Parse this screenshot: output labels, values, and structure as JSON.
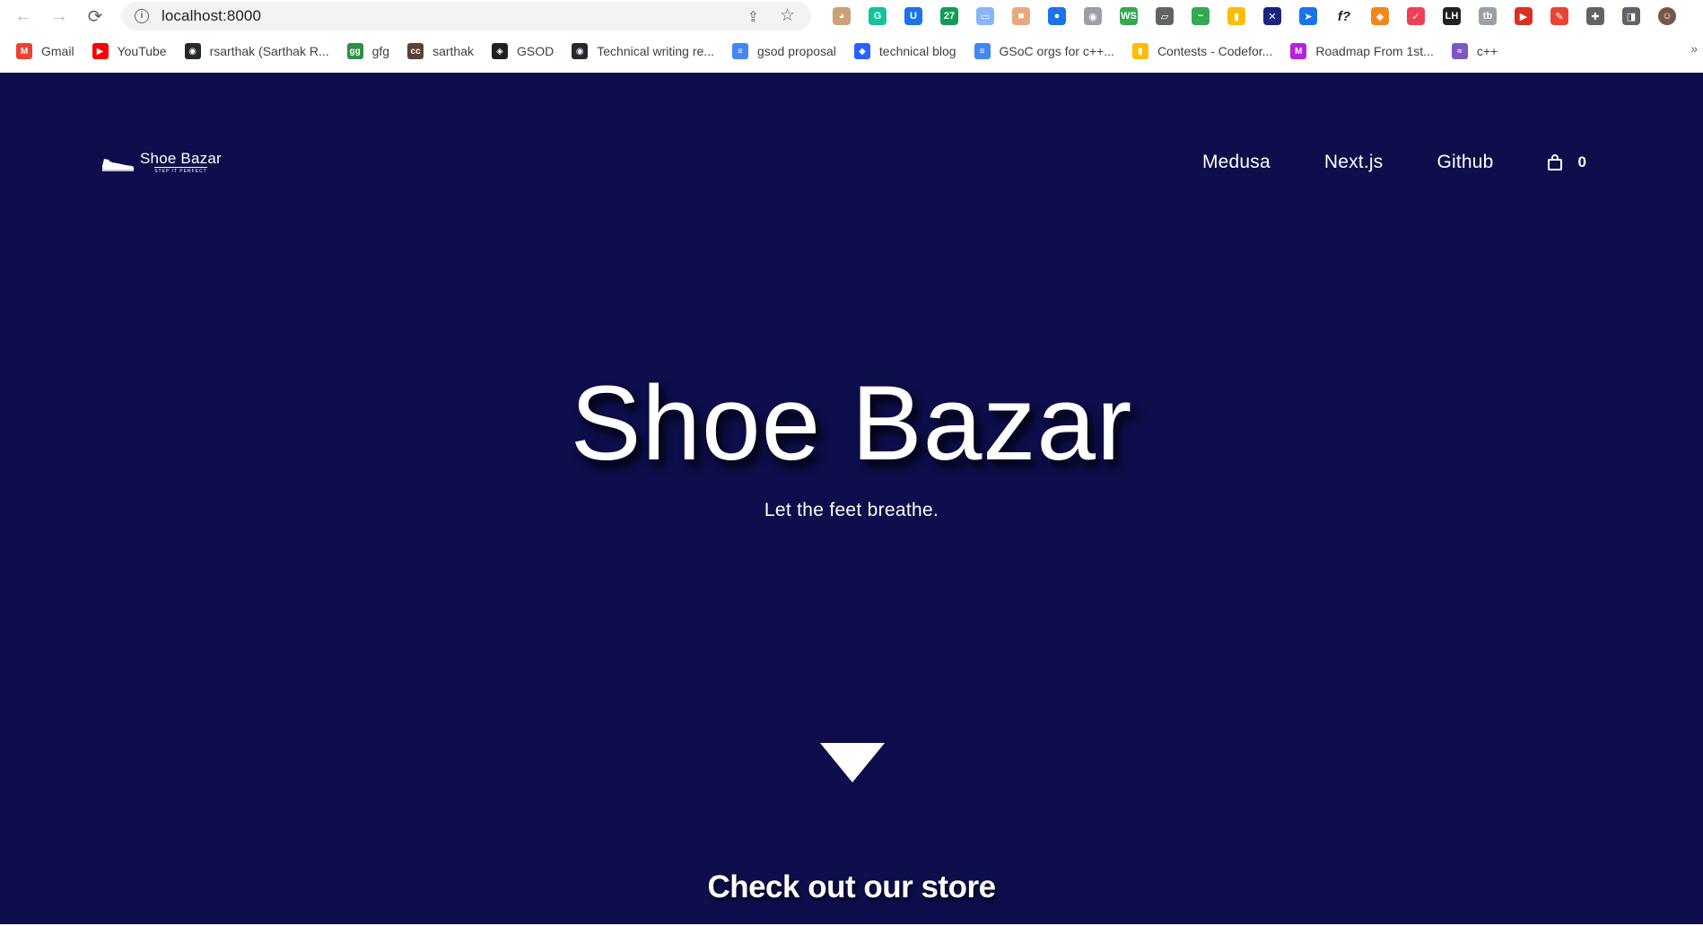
{
  "browser": {
    "url": "localhost:8000",
    "nav": {
      "back_icon": "←",
      "forward_icon": "→",
      "reload_icon": "⟳"
    },
    "extensions": [
      {
        "name": "face-ext-icon",
        "label": "◕",
        "color": "#c9a27a"
      },
      {
        "name": "grammarly-icon",
        "label": "G",
        "color": "#15c39a"
      },
      {
        "name": "u-ext-icon",
        "label": "U",
        "color": "#1a73e8"
      },
      {
        "name": "calendar-27-icon",
        "label": "27",
        "color": "#0f9d58"
      },
      {
        "name": "tab-ext-icon",
        "label": "▭",
        "color": "#8ab4f8"
      },
      {
        "name": "box-ext-icon",
        "label": "■",
        "color": "#e8a87c"
      },
      {
        "name": "screen-capture-icon",
        "label": "●",
        "color": "#1a73e8"
      },
      {
        "name": "disc-ext-icon",
        "label": "◉",
        "color": "#9aa0a6"
      },
      {
        "name": "ws-ext-icon",
        "label": "WS",
        "color": "#34a853"
      },
      {
        "name": "cast-icon",
        "label": "▱",
        "color": "#5f6368"
      },
      {
        "name": "wave-ext-icon",
        "label": "~",
        "color": "#34a853"
      },
      {
        "name": "bar-chart-ext-icon",
        "label": "▮",
        "color": "#fbbc04"
      },
      {
        "name": "tools-ext-icon",
        "label": "✕",
        "color": "#1a237e"
      },
      {
        "name": "send-ext-icon",
        "label": "➤",
        "color": "#1a73e8"
      },
      {
        "name": "f-question-icon",
        "label": "f?",
        "color": "#ffffff"
      },
      {
        "name": "metamask-icon",
        "label": "◆",
        "color": "#f6851b"
      },
      {
        "name": "pocket-icon",
        "label": "✓",
        "color": "#ef4056"
      },
      {
        "name": "lh-ext-icon",
        "label": "LH",
        "color": "#202124"
      },
      {
        "name": "tb-ext-icon",
        "label": "tb",
        "color": "#9aa0a6"
      },
      {
        "name": "red-shield-icon",
        "label": "▶",
        "color": "#d93025"
      },
      {
        "name": "pen-ext-icon",
        "label": "✎",
        "color": "#ea4335"
      },
      {
        "name": "puzzle-icon",
        "label": "✚",
        "color": "#5f6368"
      },
      {
        "name": "side-panel-icon",
        "label": "◨",
        "color": "#5f6368"
      },
      {
        "name": "profile-avatar",
        "label": "☺",
        "color": "#795548"
      }
    ],
    "bookmarks": [
      {
        "label": "Gmail",
        "icon": "M",
        "color": "#ea4335",
        "name": "gmail-icon"
      },
      {
        "label": "YouTube",
        "icon": "▶",
        "color": "#ff0000",
        "name": "youtube-icon"
      },
      {
        "label": "rsarthak (Sarthak R...",
        "icon": "◉",
        "color": "#24292f",
        "name": "github-icon"
      },
      {
        "label": "gfg",
        "icon": "gg",
        "color": "#2f8d46",
        "name": "gfg-icon"
      },
      {
        "label": "sarthak",
        "icon": "cc",
        "color": "#5c4033",
        "name": "codechef-icon"
      },
      {
        "label": "GSOD",
        "icon": "◈",
        "color": "#202124",
        "name": "gsod-icon"
      },
      {
        "label": "Technical writing re...",
        "icon": "◉",
        "color": "#24292f",
        "name": "github-icon"
      },
      {
        "label": "gsod proposal",
        "icon": "≡",
        "color": "#4285f4",
        "name": "docs-icon"
      },
      {
        "label": "technical blog",
        "icon": "◆",
        "color": "#2962ff",
        "name": "blog-icon"
      },
      {
        "label": "GSoC orgs for c++...",
        "icon": "≡",
        "color": "#4285f4",
        "name": "docs-icon"
      },
      {
        "label": "Contests - Codefor...",
        "icon": "▮",
        "color": "#fbbc04",
        "name": "codeforces-icon"
      },
      {
        "label": "Roadmap From 1st...",
        "icon": "M",
        "color": "#b620e0",
        "name": "medium-icon"
      },
      {
        "label": "c++",
        "icon": "≈",
        "color": "#7e57c2",
        "name": "cpp-icon"
      }
    ],
    "overflow": "»"
  },
  "site": {
    "logo_name": "Shoe Bazar",
    "logo_tagline": "STEP IT PERFECT",
    "nav": [
      "Medusa",
      "Next.js",
      "Github"
    ],
    "cart_count": "0",
    "hero_title": "Shoe Bazar",
    "hero_subtitle": "Let the feet breathe.",
    "store_heading": "Check out our store"
  },
  "colors": {
    "page_bg": "#0d0e4b",
    "text": "#ffffff"
  }
}
